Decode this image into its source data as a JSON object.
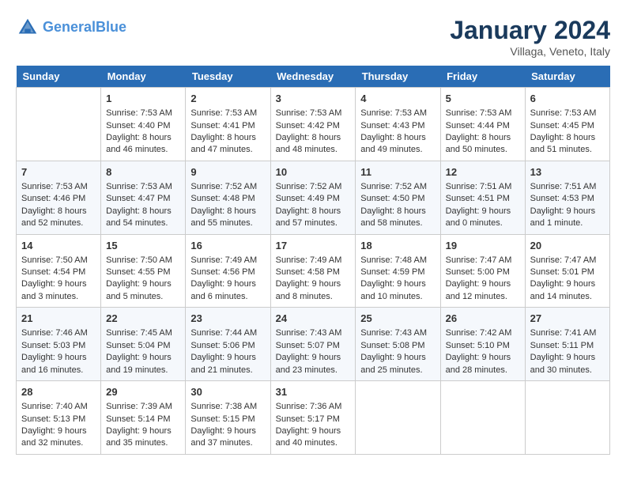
{
  "header": {
    "logo_line1": "General",
    "logo_line2": "Blue",
    "month": "January 2024",
    "location": "Villaga, Veneto, Italy"
  },
  "weekdays": [
    "Sunday",
    "Monday",
    "Tuesday",
    "Wednesday",
    "Thursday",
    "Friday",
    "Saturday"
  ],
  "weeks": [
    [
      {
        "day": "",
        "sunrise": "",
        "sunset": "",
        "daylight": ""
      },
      {
        "day": "1",
        "sunrise": "Sunrise: 7:53 AM",
        "sunset": "Sunset: 4:40 PM",
        "daylight": "Daylight: 8 hours and 46 minutes."
      },
      {
        "day": "2",
        "sunrise": "Sunrise: 7:53 AM",
        "sunset": "Sunset: 4:41 PM",
        "daylight": "Daylight: 8 hours and 47 minutes."
      },
      {
        "day": "3",
        "sunrise": "Sunrise: 7:53 AM",
        "sunset": "Sunset: 4:42 PM",
        "daylight": "Daylight: 8 hours and 48 minutes."
      },
      {
        "day": "4",
        "sunrise": "Sunrise: 7:53 AM",
        "sunset": "Sunset: 4:43 PM",
        "daylight": "Daylight: 8 hours and 49 minutes."
      },
      {
        "day": "5",
        "sunrise": "Sunrise: 7:53 AM",
        "sunset": "Sunset: 4:44 PM",
        "daylight": "Daylight: 8 hours and 50 minutes."
      },
      {
        "day": "6",
        "sunrise": "Sunrise: 7:53 AM",
        "sunset": "Sunset: 4:45 PM",
        "daylight": "Daylight: 8 hours and 51 minutes."
      }
    ],
    [
      {
        "day": "7",
        "sunrise": "Sunrise: 7:53 AM",
        "sunset": "Sunset: 4:46 PM",
        "daylight": "Daylight: 8 hours and 52 minutes."
      },
      {
        "day": "8",
        "sunrise": "Sunrise: 7:53 AM",
        "sunset": "Sunset: 4:47 PM",
        "daylight": "Daylight: 8 hours and 54 minutes."
      },
      {
        "day": "9",
        "sunrise": "Sunrise: 7:52 AM",
        "sunset": "Sunset: 4:48 PM",
        "daylight": "Daylight: 8 hours and 55 minutes."
      },
      {
        "day": "10",
        "sunrise": "Sunrise: 7:52 AM",
        "sunset": "Sunset: 4:49 PM",
        "daylight": "Daylight: 8 hours and 57 minutes."
      },
      {
        "day": "11",
        "sunrise": "Sunrise: 7:52 AM",
        "sunset": "Sunset: 4:50 PM",
        "daylight": "Daylight: 8 hours and 58 minutes."
      },
      {
        "day": "12",
        "sunrise": "Sunrise: 7:51 AM",
        "sunset": "Sunset: 4:51 PM",
        "daylight": "Daylight: 9 hours and 0 minutes."
      },
      {
        "day": "13",
        "sunrise": "Sunrise: 7:51 AM",
        "sunset": "Sunset: 4:53 PM",
        "daylight": "Daylight: 9 hours and 1 minute."
      }
    ],
    [
      {
        "day": "14",
        "sunrise": "Sunrise: 7:50 AM",
        "sunset": "Sunset: 4:54 PM",
        "daylight": "Daylight: 9 hours and 3 minutes."
      },
      {
        "day": "15",
        "sunrise": "Sunrise: 7:50 AM",
        "sunset": "Sunset: 4:55 PM",
        "daylight": "Daylight: 9 hours and 5 minutes."
      },
      {
        "day": "16",
        "sunrise": "Sunrise: 7:49 AM",
        "sunset": "Sunset: 4:56 PM",
        "daylight": "Daylight: 9 hours and 6 minutes."
      },
      {
        "day": "17",
        "sunrise": "Sunrise: 7:49 AM",
        "sunset": "Sunset: 4:58 PM",
        "daylight": "Daylight: 9 hours and 8 minutes."
      },
      {
        "day": "18",
        "sunrise": "Sunrise: 7:48 AM",
        "sunset": "Sunset: 4:59 PM",
        "daylight": "Daylight: 9 hours and 10 minutes."
      },
      {
        "day": "19",
        "sunrise": "Sunrise: 7:47 AM",
        "sunset": "Sunset: 5:00 PM",
        "daylight": "Daylight: 9 hours and 12 minutes."
      },
      {
        "day": "20",
        "sunrise": "Sunrise: 7:47 AM",
        "sunset": "Sunset: 5:01 PM",
        "daylight": "Daylight: 9 hours and 14 minutes."
      }
    ],
    [
      {
        "day": "21",
        "sunrise": "Sunrise: 7:46 AM",
        "sunset": "Sunset: 5:03 PM",
        "daylight": "Daylight: 9 hours and 16 minutes."
      },
      {
        "day": "22",
        "sunrise": "Sunrise: 7:45 AM",
        "sunset": "Sunset: 5:04 PM",
        "daylight": "Daylight: 9 hours and 19 minutes."
      },
      {
        "day": "23",
        "sunrise": "Sunrise: 7:44 AM",
        "sunset": "Sunset: 5:06 PM",
        "daylight": "Daylight: 9 hours and 21 minutes."
      },
      {
        "day": "24",
        "sunrise": "Sunrise: 7:43 AM",
        "sunset": "Sunset: 5:07 PM",
        "daylight": "Daylight: 9 hours and 23 minutes."
      },
      {
        "day": "25",
        "sunrise": "Sunrise: 7:43 AM",
        "sunset": "Sunset: 5:08 PM",
        "daylight": "Daylight: 9 hours and 25 minutes."
      },
      {
        "day": "26",
        "sunrise": "Sunrise: 7:42 AM",
        "sunset": "Sunset: 5:10 PM",
        "daylight": "Daylight: 9 hours and 28 minutes."
      },
      {
        "day": "27",
        "sunrise": "Sunrise: 7:41 AM",
        "sunset": "Sunset: 5:11 PM",
        "daylight": "Daylight: 9 hours and 30 minutes."
      }
    ],
    [
      {
        "day": "28",
        "sunrise": "Sunrise: 7:40 AM",
        "sunset": "Sunset: 5:13 PM",
        "daylight": "Daylight: 9 hours and 32 minutes."
      },
      {
        "day": "29",
        "sunrise": "Sunrise: 7:39 AM",
        "sunset": "Sunset: 5:14 PM",
        "daylight": "Daylight: 9 hours and 35 minutes."
      },
      {
        "day": "30",
        "sunrise": "Sunrise: 7:38 AM",
        "sunset": "Sunset: 5:15 PM",
        "daylight": "Daylight: 9 hours and 37 minutes."
      },
      {
        "day": "31",
        "sunrise": "Sunrise: 7:36 AM",
        "sunset": "Sunset: 5:17 PM",
        "daylight": "Daylight: 9 hours and 40 minutes."
      },
      {
        "day": "",
        "sunrise": "",
        "sunset": "",
        "daylight": ""
      },
      {
        "day": "",
        "sunrise": "",
        "sunset": "",
        "daylight": ""
      },
      {
        "day": "",
        "sunrise": "",
        "sunset": "",
        "daylight": ""
      }
    ]
  ]
}
